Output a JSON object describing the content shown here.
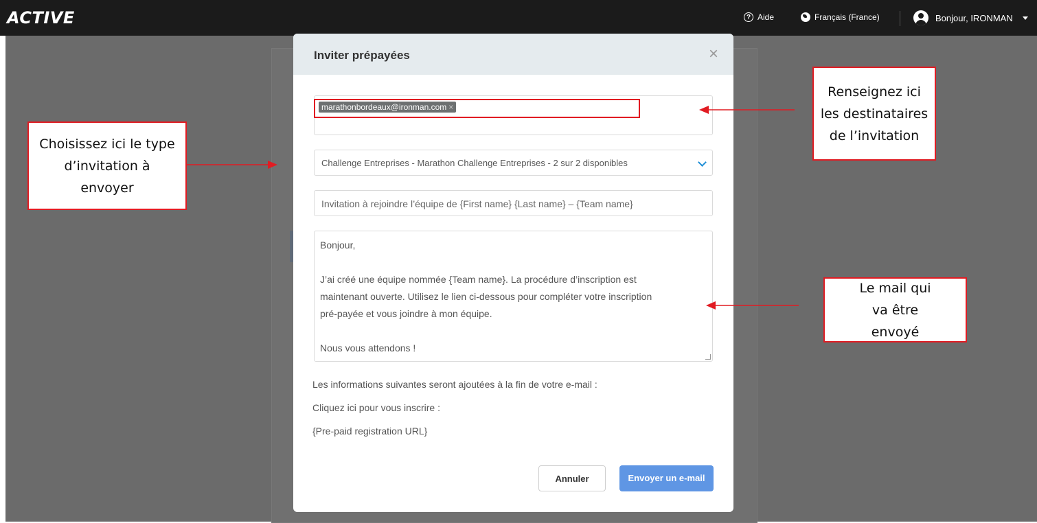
{
  "topbar": {
    "logo": "ACTIVE",
    "help_label": "Aide",
    "language_label": "Français (France)",
    "greeting": "Bonjour, IRONMAN"
  },
  "modal": {
    "title": "Inviter prépayées",
    "recipient_chip": "marathonbordeaux@ironman.com",
    "invitation_type": "Challenge Entreprises - Marathon Challenge Entreprises - 2 sur 2 disponibles",
    "subject": "Invitation à rejoindre l’équipe de {First name} {Last name} – {Team name}",
    "message": {
      "line1": "Bonjour,",
      "line2": "J’ai créé une équipe nommée {Team name}. La procédure d’inscription est",
      "line3": "maintenant ouverte. Utilisez le lien ci-dessous pour compléter votre inscription",
      "line4": "pré-payée et vous joindre à mon équipe.",
      "line5": "Nous vous attendons !"
    },
    "info1": "Les informations suivantes seront ajoutées à la fin de votre e-mail :",
    "info2": "Cliquez ici pour vous inscrire :",
    "info3": "{Pre-paid registration URL}",
    "cancel_label": "Annuler",
    "send_label": "Envoyer un e-mail"
  },
  "annotations": {
    "recipients": "Renseignez ici les destinataires de l’invitation",
    "type": "Choisissez ici le type d’invitation à envoyer",
    "mail": "Le mail qui va être envoyé"
  },
  "colors": {
    "annotation_red": "#e11b22",
    "send_button": "#5f96e4",
    "accent_chevron": "#1f8fd6"
  }
}
